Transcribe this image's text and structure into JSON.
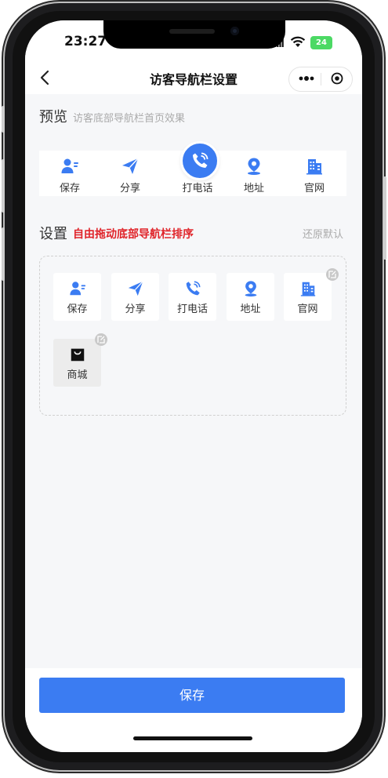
{
  "status_bar": {
    "time": "23:27",
    "battery": "24"
  },
  "navbar": {
    "title": "访客导航栏设置"
  },
  "preview": {
    "title": "预览",
    "subtitle": "访客底部导航栏首页效果",
    "items": [
      {
        "label": "保存",
        "icon": "contact-save-icon"
      },
      {
        "label": "分享",
        "icon": "paper-plane-icon"
      },
      {
        "label": "打电话",
        "icon": "phone-icon"
      },
      {
        "label": "地址",
        "icon": "location-pin-icon"
      },
      {
        "label": "官网",
        "icon": "building-icon"
      }
    ]
  },
  "settings": {
    "title": "设置",
    "hint": "自由拖动底部导航栏排序",
    "reset_label": "还原默认",
    "items": [
      {
        "label": "保存",
        "icon": "contact-save-icon"
      },
      {
        "label": "分享",
        "icon": "paper-plane-icon"
      },
      {
        "label": "打电话",
        "icon": "phone-icon"
      },
      {
        "label": "地址",
        "icon": "location-pin-icon"
      },
      {
        "label": "官网",
        "icon": "building-icon"
      },
      {
        "label": "商城",
        "icon": "shopping-bag-icon"
      }
    ]
  },
  "footer": {
    "save_label": "保存"
  },
  "colors": {
    "accent": "#3b7cf2",
    "hint_red": "#e0242a",
    "battery_green": "#4cd964"
  }
}
